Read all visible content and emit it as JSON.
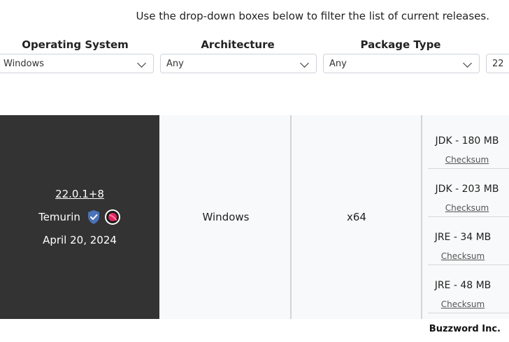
{
  "intro_text": "Use the drop-down boxes below to filter the list of current releases.",
  "filters": {
    "os": {
      "label": "Operating System",
      "value": "Windows"
    },
    "arch": {
      "label": "Architecture",
      "value": "Any"
    },
    "package": {
      "label": "Package Type",
      "value": "Any"
    },
    "version": {
      "value": "22"
    }
  },
  "release": {
    "version": "22.0.1+8",
    "vendor": "Temurin",
    "date": "April 20, 2024",
    "os": "Windows",
    "arch": "x64",
    "packages": [
      {
        "size": "JDK - 180 MB",
        "checksum": "Checksum"
      },
      {
        "size": "JDK - 203 MB",
        "checksum": "Checksum"
      },
      {
        "size": "JRE - 34 MB",
        "checksum": "Checksum"
      },
      {
        "size": "JRE - 48 MB",
        "checksum": "Checksum"
      }
    ]
  },
  "footer": {
    "brand": "Buzzword Inc."
  },
  "icons": {
    "verified": "shield-check-icon",
    "aqavit": "aqavit-badge-icon",
    "dropdown": "chevron-down-icon"
  },
  "colors": {
    "release_bg": "#333333",
    "cell_bg": "#f8f9fa",
    "shield": "#4a73b8",
    "badge": "#e0245e"
  }
}
